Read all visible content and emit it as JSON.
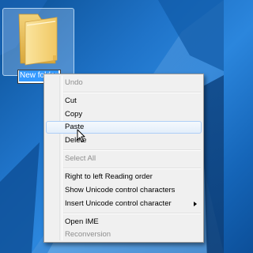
{
  "desktop": {
    "folder": {
      "icon": "folder-icon",
      "rename_value": "New folder"
    }
  },
  "context_menu": {
    "items": [
      {
        "label": "Undo",
        "enabled": false
      },
      {
        "label": "Cut",
        "enabled": true
      },
      {
        "label": "Copy",
        "enabled": true
      },
      {
        "label": "Paste",
        "enabled": true,
        "highlighted": true
      },
      {
        "label": "Delete",
        "enabled": true
      },
      {
        "label": "Select All",
        "enabled": false
      },
      {
        "label": "Right to left Reading order",
        "enabled": true
      },
      {
        "label": "Show Unicode control characters",
        "enabled": true
      },
      {
        "label": "Insert Unicode control character",
        "enabled": true,
        "has_submenu": true,
        "submenu_icon": "chevron-right-icon"
      },
      {
        "label": "Open IME",
        "enabled": true
      },
      {
        "label": "Reconversion",
        "enabled": false
      }
    ]
  },
  "colors": {
    "selection_highlight": "#3399ff",
    "menu_background": "#f0f0f0",
    "menu_hover_border": "#aecff7",
    "disabled_text": "#8e8e8e"
  }
}
